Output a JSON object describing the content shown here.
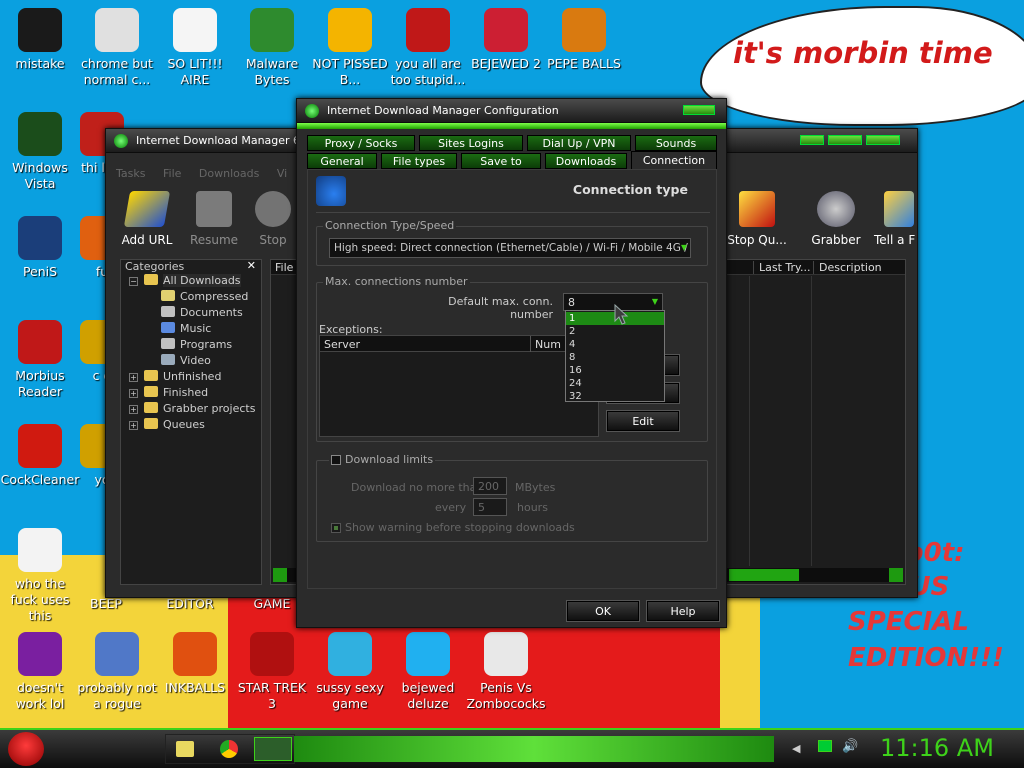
{
  "desktop": {
    "bubble_text": "it's morbin time",
    "red_lines": [
      "b0t:",
      "BIUS",
      "SPECIAL",
      "EDITION!!!"
    ],
    "icons": [
      {
        "label": "mistake",
        "icon": "ring-icon",
        "color": "#1a1a1a"
      },
      {
        "label": "chrome but normal c...",
        "icon": "chrome-icon",
        "color": "#e0e0e0"
      },
      {
        "label": "SO LIT!!! AIRE",
        "icon": "solitaire-icon",
        "color": "#f5f5f5"
      },
      {
        "label": "Malware Bytes",
        "icon": "shield-icon",
        "color": "#2e8b2e"
      },
      {
        "label": "NOT PISSED B...",
        "icon": "pig-icon",
        "color": "#f4b400"
      },
      {
        "label": "you all are too stupid...",
        "icon": "devcpp-icon",
        "color": "#c01818"
      },
      {
        "label": "BEJEWED 2",
        "icon": "bejewed-icon",
        "color": "#cc1f33"
      },
      {
        "label": "PEPE BALLS",
        "icon": "zuma-icon",
        "color": "#d97a10"
      },
      {
        "label": "Windows Vista",
        "icon": "recycle-icon",
        "color": "#1b4d1b"
      },
      {
        "label": "thi like",
        "icon": "opera-icon",
        "color": "#c0201a"
      },
      {
        "label": "PeniS",
        "icon": "photoshop-icon",
        "color": "#1b3e7a"
      },
      {
        "label": "fu",
        "icon": "firefox-icon",
        "color": "#e06010"
      },
      {
        "label": "Morbius Reader",
        "icon": "pdf-icon",
        "color": "#c01818"
      },
      {
        "label": "c g",
        "icon": "app-icon",
        "color": "#d0a000"
      },
      {
        "label": "CockCleaner",
        "icon": "ccleaner-icon",
        "color": "#d01a10"
      },
      {
        "label": "yo",
        "icon": "app-icon",
        "color": "#d0a000"
      },
      {
        "label": "who the fuck uses this",
        "icon": "flash-icon",
        "color": "#f3f3f3"
      },
      {
        "label": "doesn't work lol",
        "icon": "yahoo-icon",
        "color": "#7a1fa0"
      },
      {
        "label": "probably not a rogue",
        "icon": "settings-icon",
        "color": "#5078c8"
      },
      {
        "label": "INKBALLS",
        "icon": "inkball-icon",
        "color": "#e05010"
      },
      {
        "label": "STAR TREK 3",
        "icon": "startrek-icon",
        "color": "#b01010"
      },
      {
        "label": "sussy sexy game",
        "icon": "game-icon",
        "color": "#30b0e0"
      },
      {
        "label": "bejewed deluze",
        "icon": "diamond-icon",
        "color": "#20b0f0"
      },
      {
        "label": "Penis Vs Zombococks",
        "icon": "pvz-icon",
        "color": "#e8e8e8"
      }
    ],
    "partial_labels": [
      "EDITOR",
      "GAME",
      "BEEP"
    ]
  },
  "idm_main": {
    "title": "Internet Download Manager 6.41",
    "menu": [
      "Tasks",
      "File",
      "Downloads",
      "Vi"
    ],
    "toolbar": [
      "Add URL",
      "Resume",
      "Stop",
      "Stop Qu...",
      "Grabber",
      "Tell a F"
    ],
    "categories_title": "Categories",
    "tree": [
      {
        "label": "All Downloads",
        "level": 0
      },
      {
        "label": "Compressed",
        "level": 1
      },
      {
        "label": "Documents",
        "level": 1
      },
      {
        "label": "Music",
        "level": 1
      },
      {
        "label": "Programs",
        "level": 1
      },
      {
        "label": "Video",
        "level": 1
      },
      {
        "label": "Unfinished",
        "level": 0
      },
      {
        "label": "Finished",
        "level": 0
      },
      {
        "label": "Grabber projects",
        "level": 0
      },
      {
        "label": "Queues",
        "level": 0
      }
    ],
    "columns": [
      "File N",
      "Last Try...",
      "Description"
    ]
  },
  "config": {
    "title": "Internet Download Manager Configuration",
    "tabs_row1": [
      "Proxy / Socks",
      "Sites Logins",
      "Dial Up / VPN",
      "Sounds"
    ],
    "tabs_row2": [
      "General",
      "File types",
      "Save to",
      "Downloads",
      "Connection"
    ],
    "header": "Connection type",
    "type_group": "Connection Type/Speed",
    "type_value": "High speed: Direct connection (Ethernet/Cable) / Wi-Fi / Mobile 4G / oth",
    "max_group": "Max. connections number",
    "default_label": "Default max. conn. number",
    "default_value": "8",
    "dropdown_options": [
      "1",
      "2",
      "4",
      "8",
      "16",
      "24",
      "32"
    ],
    "exceptions_label": "Exceptions:",
    "exc_cols": [
      "Server",
      "Num"
    ],
    "edit_btn": "Edit",
    "limits_label": "Download limits",
    "no_more_than": "Download no more than",
    "mb_value": "200",
    "mbytes": "MBytes",
    "every": "every",
    "hours_value": "5",
    "hours": "hours",
    "warning": "Show warning before stopping downloads",
    "ok": "OK",
    "help": "Help"
  },
  "taskbar": {
    "clock": "11:16 AM"
  }
}
